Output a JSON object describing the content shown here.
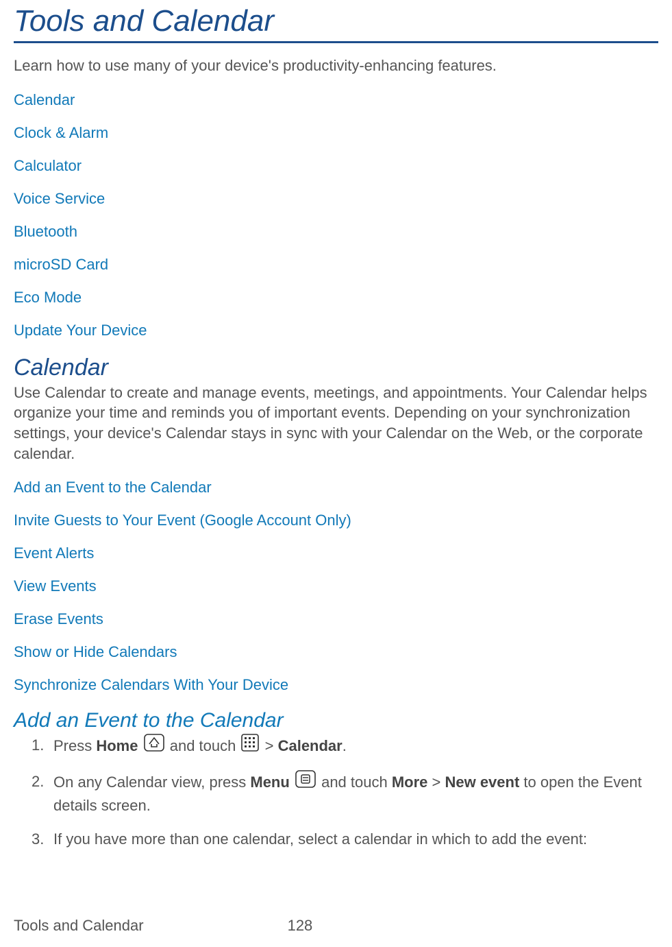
{
  "page": {
    "title": "Tools and Calendar",
    "intro": "Learn how to use many of your device's productivity-enhancing features."
  },
  "toc": [
    "Calendar",
    "Clock & Alarm",
    "Calculator",
    "Voice Service",
    "Bluetooth",
    "microSD Card",
    "Eco Mode",
    "Update Your Device"
  ],
  "calendar_section": {
    "title": "Calendar",
    "body": "Use Calendar to create and manage events, meetings, and appointments. Your Calendar helps organize your time and reminds you of important events. Depending on your synchronization settings, your device's Calendar stays in sync with your Calendar on the Web, or the corporate calendar.",
    "links": [
      "Add an Event to the Calendar",
      "Invite Guests to Your Event (Google Account Only)",
      "Event Alerts",
      "View Events",
      "Erase Events",
      "Show or Hide Calendars",
      "Synchronize Calendars With Your Device"
    ]
  },
  "add_event": {
    "title": "Add an Event to the Calendar",
    "step1": {
      "press": "Press ",
      "home": "Home",
      "and_touch": " and touch ",
      "gt": " > ",
      "calendar": "Calendar",
      "dot": "."
    },
    "step2": {
      "t1": "On any Calendar view, press ",
      "menu": "Menu",
      "t2": " and touch ",
      "more": "More",
      "gt": " > ",
      "newevent": "New event",
      "t3": " to open the Event details screen."
    },
    "step3": "If you have more than one calendar, select a calendar in which to add the event:"
  },
  "footer": {
    "left": "Tools and Calendar",
    "page_num": "128"
  }
}
